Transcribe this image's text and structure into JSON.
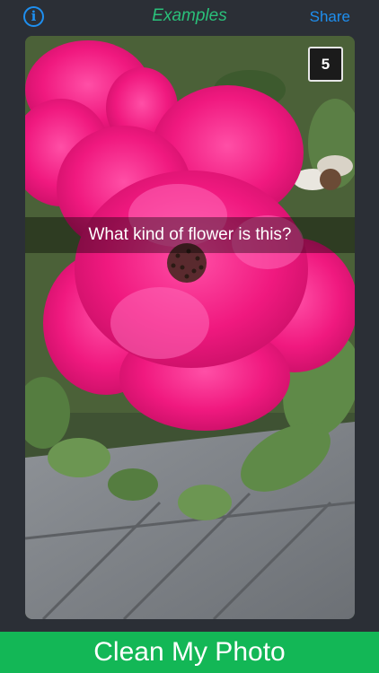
{
  "navbar": {
    "info_icon": "info-icon",
    "info_glyph": "i",
    "title": "Examples",
    "share_label": "Share"
  },
  "photo": {
    "counter": "5",
    "caption": "What kind of flower is this?"
  },
  "action": {
    "label": "Clean My Photo"
  },
  "colors": {
    "background": "#2b2f36",
    "title_green": "#2ac07a",
    "link_blue": "#1e8ff0",
    "action_green": "#13b756",
    "flower_pink": "#f0197f"
  }
}
